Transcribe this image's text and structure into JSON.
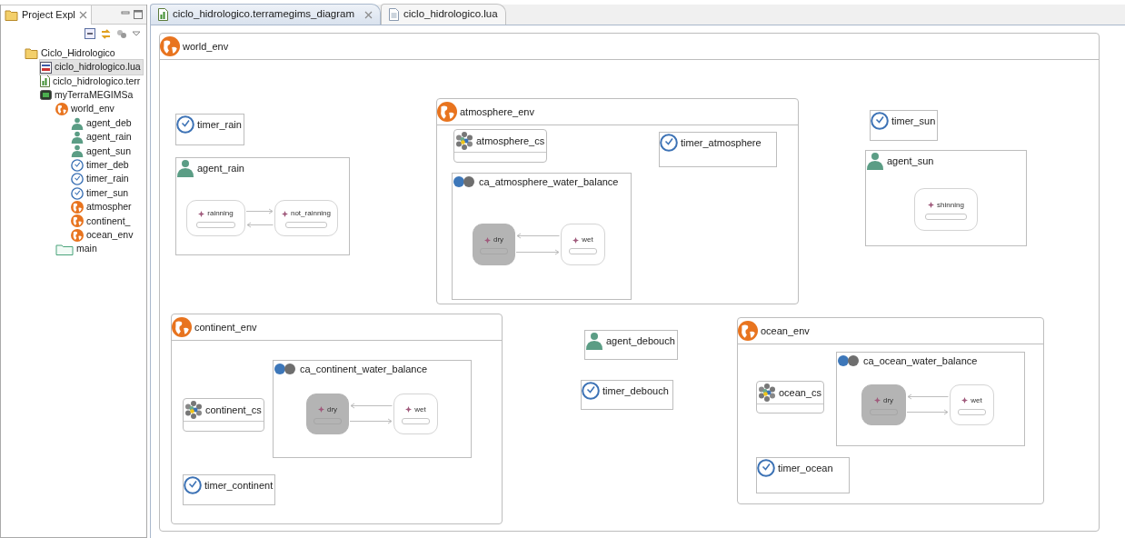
{
  "explorer": {
    "title": "Project Expl",
    "tree": [
      {
        "label": "Ciclo_Hidrologico",
        "kind": "project",
        "selected": false,
        "children": [
          {
            "label": "ciclo_hidrologico.lua",
            "kind": "lua",
            "selected": true
          },
          {
            "label": "ciclo_hidrologico.terr",
            "kind": "diagram",
            "selected": false
          },
          {
            "label": "myTerraMEGIMSa",
            "kind": "model",
            "selected": false,
            "children": [
              {
                "label": "world_env",
                "kind": "env",
                "selected": false,
                "children": [
                  {
                    "label": "agent_deb",
                    "kind": "agent",
                    "selected": false
                  },
                  {
                    "label": "agent_rain",
                    "kind": "agent",
                    "selected": false
                  },
                  {
                    "label": "agent_sun",
                    "kind": "agent",
                    "selected": false
                  },
                  {
                    "label": "timer_deb",
                    "kind": "timer",
                    "selected": false
                  },
                  {
                    "label": "timer_rain",
                    "kind": "timer",
                    "selected": false
                  },
                  {
                    "label": "timer_sun",
                    "kind": "timer",
                    "selected": false
                  },
                  {
                    "label": "atmospher",
                    "kind": "env",
                    "selected": false
                  },
                  {
                    "label": "continent_",
                    "kind": "env",
                    "selected": false
                  },
                  {
                    "label": "ocean_env",
                    "kind": "env",
                    "selected": false
                  }
                ]
              },
              {
                "label": "main",
                "kind": "main",
                "selected": false
              }
            ]
          }
        ]
      }
    ]
  },
  "tabs": [
    {
      "label": "ciclo_hidrologico.terramegims_diagram",
      "kind": "diagram",
      "selected": true
    },
    {
      "label": "ciclo_hidrologico.lua",
      "kind": "text",
      "selected": false
    }
  ],
  "diagram": {
    "kind": "env",
    "label": "world_env",
    "children": [
      {
        "kind": "timer",
        "label": "timer_rain"
      },
      {
        "kind": "agent",
        "label": "agent_rain",
        "states": [
          {
            "label": "rainning",
            "active": false
          },
          {
            "label": "not_rainning",
            "active": false
          }
        ]
      },
      {
        "kind": "env",
        "label": "atmosphere_env",
        "children": [
          {
            "kind": "cs",
            "label": "atmosphere_cs"
          },
          {
            "kind": "timer",
            "label": "timer_atmosphere"
          },
          {
            "kind": "ca",
            "label": "ca_atmosphere_water_balance",
            "states": [
              {
                "label": "dry",
                "active": true
              },
              {
                "label": "wet",
                "active": false
              }
            ]
          }
        ]
      },
      {
        "kind": "timer",
        "label": "timer_sun"
      },
      {
        "kind": "agent",
        "label": "agent_sun",
        "states": [
          {
            "label": "shinning",
            "active": false
          }
        ]
      },
      {
        "kind": "env",
        "label": "continent_env",
        "children": [
          {
            "kind": "cs",
            "label": "continent_cs"
          },
          {
            "kind": "ca",
            "label": "ca_continent_water_balance",
            "states": [
              {
                "label": "dry",
                "active": true
              },
              {
                "label": "wet",
                "active": false
              }
            ]
          },
          {
            "kind": "timer",
            "label": "timer_continent"
          }
        ]
      },
      {
        "kind": "agent",
        "label": "agent_debouch"
      },
      {
        "kind": "timer",
        "label": "timer_debouch"
      },
      {
        "kind": "env",
        "label": "ocean_env",
        "children": [
          {
            "kind": "cs",
            "label": "ocean_cs"
          },
          {
            "kind": "ca",
            "label": "ca_ocean_water_balance",
            "states": [
              {
                "label": "dry",
                "active": true
              },
              {
                "label": "wet",
                "active": false
              }
            ]
          },
          {
            "kind": "timer",
            "label": "timer_ocean"
          }
        ]
      }
    ]
  }
}
